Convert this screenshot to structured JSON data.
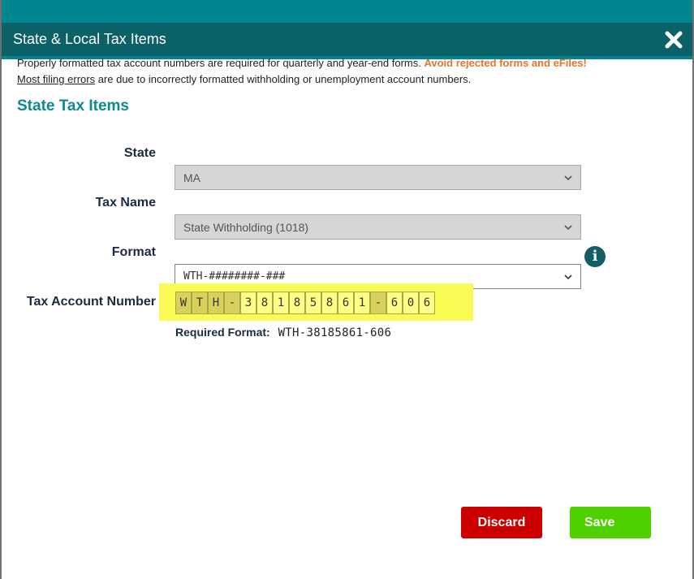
{
  "modal": {
    "title": "State & Local Tax Items",
    "close_icon": "close-x-icon"
  },
  "notice": {
    "text": "Properly formatted tax account numbers are required for quarterly and year-end forms. ",
    "warning": "Avoid rejected forms and eFiles!",
    "link": "Most filing errors",
    "text2": " are due to incorrectly formatted withholding or unemployment account numbers."
  },
  "section_title": "State Tax Items",
  "fields": {
    "state": {
      "label": "State",
      "value": "MA"
    },
    "tax_name": {
      "label": "Tax Name",
      "value": "State Withholding (1018)"
    },
    "format": {
      "label": "Format",
      "value": "WTH-########-###"
    },
    "account": {
      "label": "Tax Account Number",
      "chars": [
        "W",
        "T",
        "H",
        "-",
        "3",
        "8",
        "1",
        "8",
        "5",
        "8",
        "6",
        "1",
        "-",
        "6",
        "0",
        "6"
      ],
      "fixed_flags": [
        true,
        true,
        true,
        true,
        false,
        false,
        false,
        false,
        false,
        false,
        false,
        false,
        true,
        false,
        false,
        false
      ]
    },
    "required_format": {
      "label": "Required Format:",
      "value": "WTH-38185861-606"
    }
  },
  "buttons": {
    "discard": "Discard",
    "save": "Save"
  },
  "colors": {
    "header": "#0a6168",
    "accent": "#00868f",
    "title": "#0b8a92",
    "warning": "#e8742c",
    "discard": "#cc0000",
    "save": "#4fd100",
    "highlight": "#fbfb55"
  }
}
